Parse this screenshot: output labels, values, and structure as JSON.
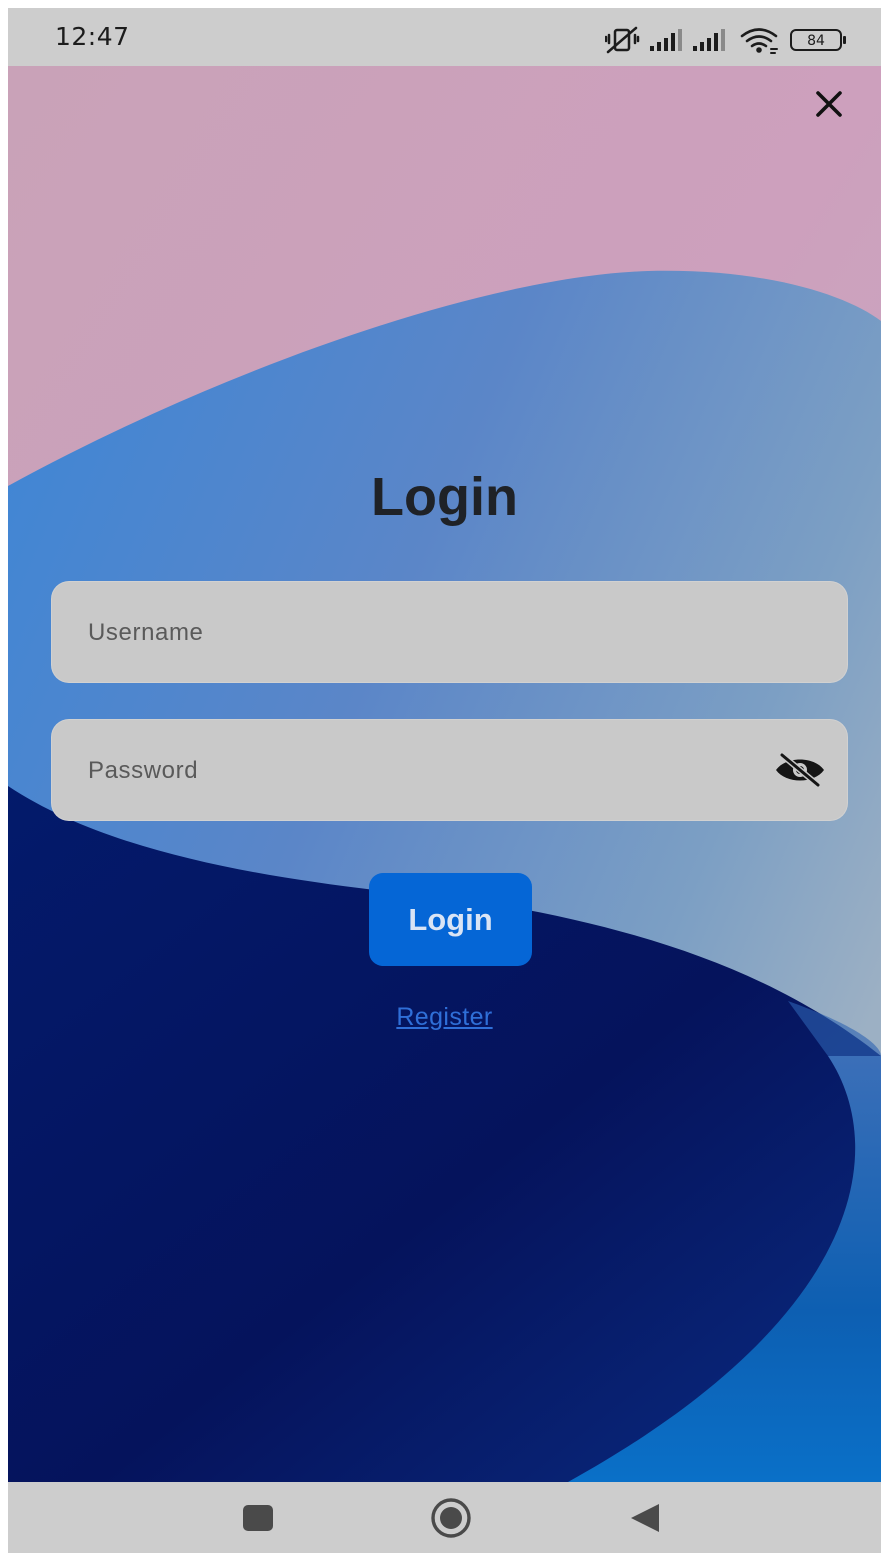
{
  "status_bar": {
    "time": "12:47",
    "battery": "84",
    "icons": [
      "vibrate-off-icon",
      "signal-icon",
      "signal-icon",
      "wifi-icon",
      "battery-icon"
    ]
  },
  "header": {
    "close_icon": "close-icon"
  },
  "login": {
    "title": "Login",
    "username_placeholder": "Username",
    "password_placeholder": "Password",
    "password_toggle_icon": "eye-slash-icon",
    "submit_label": "Login",
    "register_label": "Register"
  },
  "nav_bar": {
    "icons": [
      "recents-square-icon",
      "home-circle-icon",
      "back-triangle-icon"
    ]
  },
  "colors": {
    "primary_button": "#0566d6",
    "link": "#2f6fd8",
    "field_bg": "#c9c9c9",
    "title": "#1f2227"
  }
}
